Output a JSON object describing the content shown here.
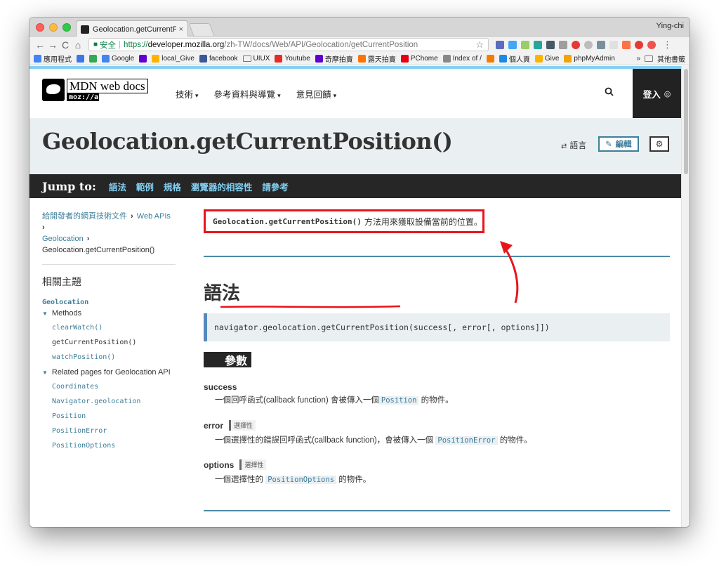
{
  "browser": {
    "tab_title": "Geolocation.getCurrentPositio",
    "tab_close": "×",
    "profile": "Ying-chi",
    "nav": {
      "back": "←",
      "forward": "→",
      "reload": "C",
      "home": "⌂"
    },
    "secure_label": "安全",
    "url_proto": "https://",
    "url_host": "developer.mozilla.org",
    "url_path": "/zh-TW/docs/Web/API/Geolocation/getCurrentPosition",
    "star": "☆",
    "menu": "⋮",
    "bookmarks": [
      {
        "label": "應用程式",
        "color": "#4285f4"
      },
      {
        "label": "",
        "color": "#3b78e7"
      },
      {
        "label": "",
        "color": "#34a853"
      },
      {
        "label": "Google",
        "color": "#4285f4"
      },
      {
        "label": "",
        "color": "#6001d2"
      },
      {
        "label": "local_Give",
        "color": "#ffb300"
      },
      {
        "label": "facebook",
        "color": "#3b5998"
      },
      {
        "label": "UIUX",
        "color": "folder"
      },
      {
        "label": "Youtube",
        "color": "#e52d27"
      },
      {
        "label": "奇摩拍賣",
        "color": "#6001d2"
      },
      {
        "label": "露天拍賣",
        "color": "#ff7300"
      },
      {
        "label": "PChome",
        "color": "#e60012"
      },
      {
        "label": "Index of /",
        "color": "#888888"
      },
      {
        "label": "",
        "color": "#f57c00"
      },
      {
        "label": "個人頁",
        "color": "#1e88e5"
      },
      {
        "label": "Give",
        "color": "#ffb300"
      },
      {
        "label": "phpMyAdmin",
        "color": "#f0a30a"
      }
    ],
    "bookmarks_more": "»",
    "bookmarks_other": "其他書籤"
  },
  "header": {
    "logo_main": "MDN web docs",
    "logo_sub": "moz://a",
    "nav": [
      {
        "label": "技術"
      },
      {
        "label": "參考資料與導覽"
      },
      {
        "label": "意見回饋"
      }
    ],
    "caret": "▾",
    "search_icon": "🔍",
    "login": "登入"
  },
  "title_band": {
    "title": "Geolocation.getCurrentPosition()",
    "lang": "語言",
    "edit": "編輯",
    "settings": "⚙"
  },
  "jumpbar": {
    "label": "Jump to:",
    "links": [
      "語法",
      "範例",
      "規格",
      "瀏覽器的相容性",
      "請參考"
    ]
  },
  "sidebar": {
    "breadcrumb": {
      "root": "給開發者的網頁技術文件",
      "web_apis": "Web APIs",
      "geolocation": "Geolocation",
      "current": "Geolocation.getCurrentPosition()"
    },
    "related_heading": "相關主題",
    "geolocation": "Geolocation",
    "methods_label": "Methods",
    "methods": [
      "clearWatch()",
      "getCurrentPosition()",
      "watchPosition()"
    ],
    "related_label": "Related pages for Geolocation API",
    "related": [
      "Coordinates",
      "Navigator.geolocation",
      "Position",
      "PositionError",
      "PositionOptions"
    ]
  },
  "article": {
    "summary_code": "Geolocation.getCurrentPosition()",
    "summary_text": "方法用來獲取設備當前的位置。",
    "syntax_heading": "語法",
    "syntax": "navigator.geolocation.getCurrentPosition(success[, error[, options]])",
    "params_heading": "參數",
    "params": [
      {
        "name": "success",
        "badge": "",
        "desc_before": "一個回呼函式(callback function) 會被傳入一個",
        "code": "Position",
        "desc_after": "的物件。"
      },
      {
        "name": "error",
        "badge": "選擇性",
        "desc_before": "一個選擇性的錯誤回呼函式(callback function)，會被傳入一個 ",
        "code": "PositionError",
        "desc_after": "的物件。"
      },
      {
        "name": "options",
        "badge": "選擇性",
        "desc_before": "一個選擇性的 ",
        "code": "PositionOptions",
        "desc_after": "的物件。"
      }
    ]
  },
  "colors": {
    "annotation_red": "#e8141b",
    "link_blue": "#3d7e9a",
    "top_accent": "#83d0f2",
    "jump_bar": "#262626"
  }
}
